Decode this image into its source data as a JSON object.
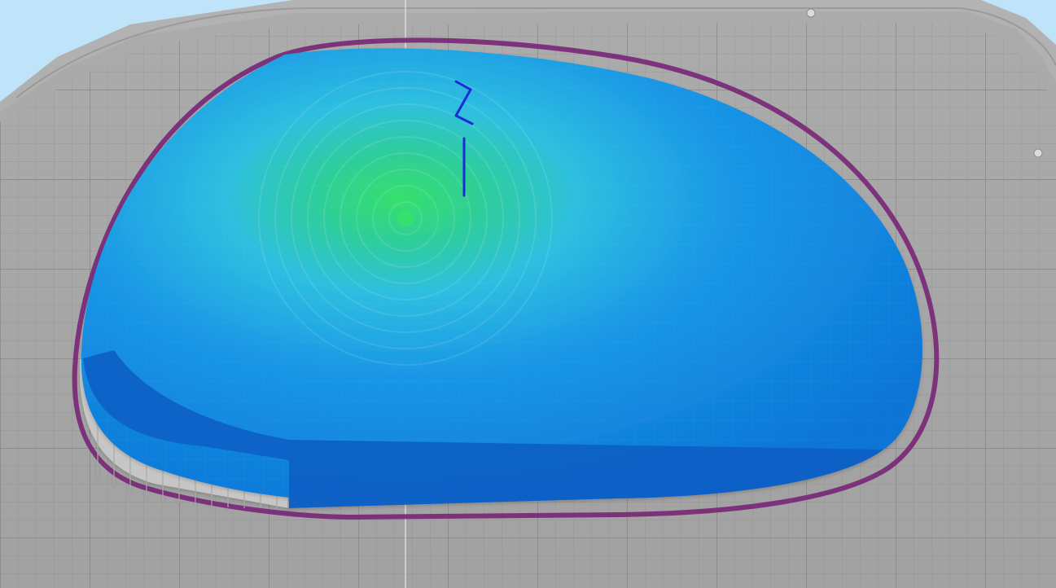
{
  "viewport": {
    "kind": "3d-slicer-layer-preview"
  },
  "colors": {
    "sky": "#bfe3f8",
    "bed_light": "#a9a9a9",
    "bed_mid": "#9b9b9b",
    "bed_rim": "#8f8f8f",
    "grid_line": "#7a7a7a",
    "grid_line_minor": "#8a8a8a",
    "skirt": "#7a2c78",
    "part_blue": "#0a74d6",
    "part_blue_dark": "#0b61c5",
    "part_cyan": "#2ebfe0",
    "part_green": "#35e06b",
    "support_gray": "#c7c7c7",
    "support_shadow": "#9f9f9f",
    "travel_move": "#1a2bd8",
    "axis_line": "#e6e6e6"
  },
  "objects": {
    "build_plate": "build-plate",
    "printed_part": "printed-part",
    "skirt": "skirt-outline",
    "support": "support-structure",
    "toolpath_marker": "travel-move-marker",
    "vertical_axis": "vertical-axis-line"
  }
}
